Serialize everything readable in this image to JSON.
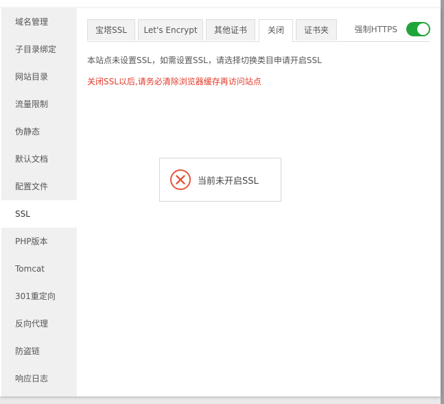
{
  "sidebar": {
    "items": [
      {
        "label": "域名管理"
      },
      {
        "label": "子目录绑定"
      },
      {
        "label": "网站目录"
      },
      {
        "label": "流量限制"
      },
      {
        "label": "伪静态"
      },
      {
        "label": "默认文档"
      },
      {
        "label": "配置文件"
      },
      {
        "label": "SSL",
        "active": true
      },
      {
        "label": "PHP版本"
      },
      {
        "label": "Tomcat"
      },
      {
        "label": "301重定向"
      },
      {
        "label": "反向代理"
      },
      {
        "label": "防盗链"
      },
      {
        "label": "响应日志"
      }
    ]
  },
  "tabs": [
    {
      "label": "宝塔SSL"
    },
    {
      "label": "Let's Encrypt"
    },
    {
      "label": "其他证书"
    },
    {
      "label": "关闭",
      "active": true
    },
    {
      "label": "证书夹"
    }
  ],
  "force_https": {
    "label": "强制HTTPS",
    "enabled": true
  },
  "content": {
    "description": "本站点未设置SSL，如需设置SSL，请选择切换类目申请开启SSL",
    "warning": "关闭SSL以后,请务必清除浏览器缓存再访问站点"
  },
  "message": {
    "text": "当前未开启SSL",
    "icon": "error-circle-icon"
  },
  "colors": {
    "accent": "#20a53a",
    "warning": "#e23a2a",
    "error_icon": "#e5553b"
  }
}
